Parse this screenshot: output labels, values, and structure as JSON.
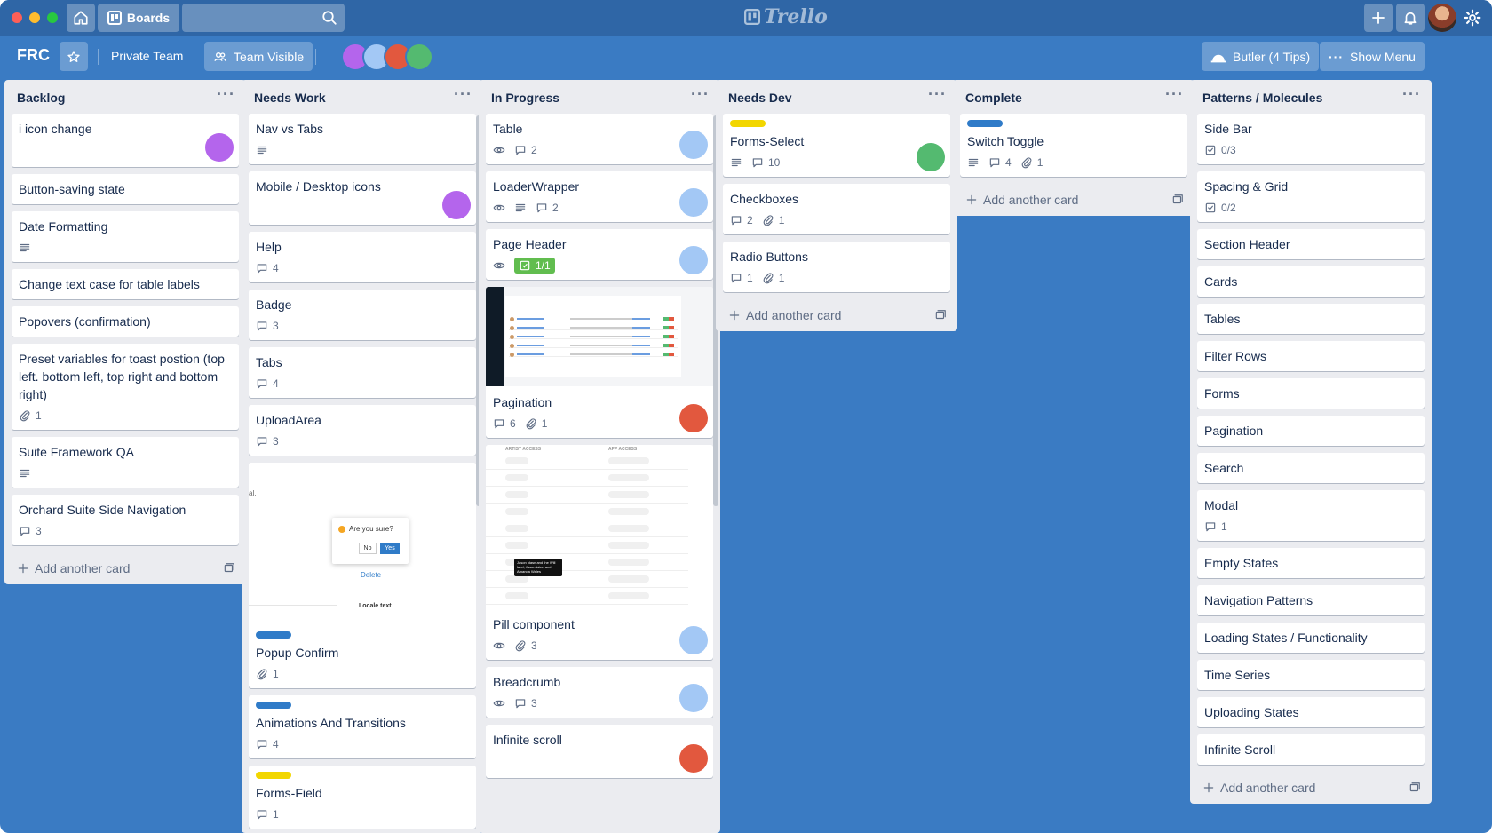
{
  "topbar": {
    "boards_label": "Boards",
    "logo_text": "Trello"
  },
  "board": {
    "name": "FRC",
    "team": "Private Team",
    "visibility": "Team Visible",
    "butler": "Butler (4 Tips)",
    "show_menu": "Show Menu",
    "member_colors": [
      "#b465ec",
      "#a3c8f5",
      "#e2583e",
      "#54ba70"
    ]
  },
  "colors": {
    "purple": "#b465ec",
    "blue": "#a3c8f5",
    "red": "#e2583e",
    "green": "#54ba70",
    "label_blue": "#2f7bc8",
    "label_yellow": "#f2d600"
  },
  "add_card_label": "Add another card",
  "lists": [
    {
      "title": "Backlog",
      "cards": [
        {
          "title": "i icon change",
          "avatar": "purple"
        },
        {
          "title": "Button-saving state"
        },
        {
          "title": "Date Formatting",
          "desc": true
        },
        {
          "title": "Change text case for table labels"
        },
        {
          "title": "Popovers (confirmation)"
        },
        {
          "title": "Preset variables for toast postion (top left. bottom left, top right and bottom right)",
          "attachments": "1"
        },
        {
          "title": "Suite Framework QA",
          "desc": true
        },
        {
          "title": "Orchard Suite Side Navigation",
          "comments": "3"
        }
      ]
    },
    {
      "title": "Needs Work",
      "cards": [
        {
          "title": "Nav vs Tabs",
          "desc": true
        },
        {
          "title": "Mobile / Desktop icons",
          "avatar": "purple"
        },
        {
          "title": "Help",
          "comments": "4"
        },
        {
          "title": "Badge",
          "comments": "3"
        },
        {
          "title": "Tabs",
          "comments": "4"
        },
        {
          "title": "UploadArea",
          "comments": "3"
        },
        {
          "title": "Popup Confirm",
          "attachments": "1",
          "label": "label_blue",
          "cover": "popup",
          "cover_text": {
            "question": "Are you sure?",
            "no": "No",
            "yes": "Yes",
            "delete": "Delete",
            "locale": "Locale text",
            "edge": "al."
          }
        },
        {
          "title": "Animations And Transitions",
          "comments": "4",
          "label": "label_blue"
        },
        {
          "title": "Forms-Field",
          "comments": "1",
          "label": "label_yellow"
        }
      ]
    },
    {
      "title": "In Progress",
      "cards": [
        {
          "title": "Table",
          "watch": true,
          "comments": "2",
          "avatar": "blue"
        },
        {
          "title": "LoaderWrapper",
          "watch": true,
          "desc": true,
          "comments": "2",
          "avatar": "blue"
        },
        {
          "title": "Page Header",
          "watch": true,
          "checklist": "1/1",
          "checklist_done": true,
          "avatar": "blue"
        },
        {
          "title": "Pagination",
          "comments": "6",
          "attachments": "1",
          "avatar": "red",
          "cover": "table"
        },
        {
          "title": "Pill component",
          "watch": true,
          "attachments": "3",
          "avatar": "blue",
          "cover": "pills",
          "cover_text": {
            "col1": "ARTIST ACCESS",
            "col2": "APP ACCESS",
            "tooltip": "Jason ldasn and the Will land, Jason lalcel and Amanda Wales"
          }
        },
        {
          "title": "Breadcrumb",
          "watch": true,
          "comments": "3",
          "avatar": "blue"
        },
        {
          "title": "Infinite scroll",
          "avatar": "red"
        }
      ]
    },
    {
      "title": "Needs Dev",
      "cards": [
        {
          "title": "Forms-Select",
          "desc": true,
          "comments": "10",
          "avatar": "green",
          "label": "label_yellow"
        },
        {
          "title": "Checkboxes",
          "comments": "2",
          "attachments": "1"
        },
        {
          "title": "Radio Buttons",
          "comments": "1",
          "attachments": "1"
        }
      ]
    },
    {
      "title": "Complete",
      "cards": [
        {
          "title": "Switch Toggle",
          "desc": true,
          "comments": "4",
          "attachments": "1",
          "label": "label_blue"
        }
      ]
    },
    {
      "title": "Patterns / Molecules",
      "cards": [
        {
          "title": "Side Bar",
          "checklist": "0/3"
        },
        {
          "title": "Spacing & Grid",
          "checklist": "0/2"
        },
        {
          "title": "Section Header"
        },
        {
          "title": "Cards"
        },
        {
          "title": "Tables"
        },
        {
          "title": "Filter Rows"
        },
        {
          "title": "Forms"
        },
        {
          "title": "Pagination"
        },
        {
          "title": "Search"
        },
        {
          "title": "Modal",
          "comments": "1"
        },
        {
          "title": "Empty States"
        },
        {
          "title": "Navigation Patterns"
        },
        {
          "title": "Loading States / Functionality"
        },
        {
          "title": "Time Series"
        },
        {
          "title": "Uploading States"
        },
        {
          "title": "Infinite Scroll"
        }
      ]
    }
  ]
}
